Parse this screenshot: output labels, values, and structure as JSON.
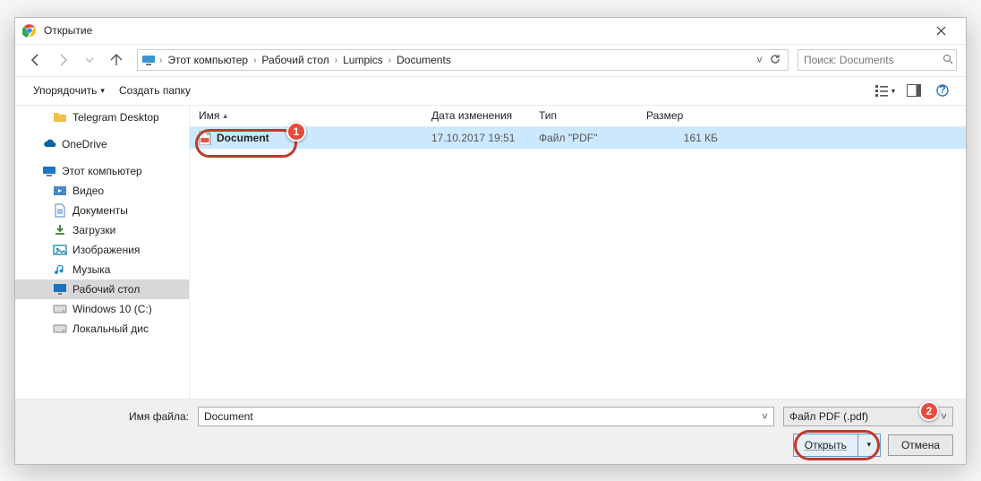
{
  "window": {
    "title": "Открытие"
  },
  "nav": {
    "breadcrumb": [
      "Этот компьютер",
      "Рабочий стол",
      "Lumpics",
      "Documents"
    ],
    "search_placeholder": "Поиск: Documents"
  },
  "toolbar": {
    "organize": "Упорядочить",
    "newfolder": "Создать папку"
  },
  "sidebar": [
    {
      "label": "Telegram Desktop",
      "icon": "folder-icon",
      "color": "#f3c14b",
      "indent": true
    },
    {
      "label": "OneDrive",
      "icon": "cloud-icon",
      "color": "#0a64a4",
      "sep": true
    },
    {
      "label": "Этот компьютер",
      "icon": "pc-icon",
      "color": "#1a74c3",
      "sep": true
    },
    {
      "label": "Видео",
      "icon": "video-icon",
      "color": "#4a86c5",
      "indent": true
    },
    {
      "label": "Документы",
      "icon": "doc-icon",
      "color": "#4a86c5",
      "indent": true
    },
    {
      "label": "Загрузки",
      "icon": "download-icon",
      "color": "#3b7a2e",
      "indent": true
    },
    {
      "label": "Изображения",
      "icon": "image-icon",
      "color": "#2b8fb3",
      "indent": true
    },
    {
      "label": "Музыка",
      "icon": "music-icon",
      "color": "#1a8fd2",
      "indent": true
    },
    {
      "label": "Рабочий стол",
      "icon": "desktop-icon",
      "color": "#1a74c3",
      "indent": true,
      "sel": true
    },
    {
      "label": "Windows 10 (C:)",
      "icon": "drive-icon",
      "color": "#888",
      "indent": true
    },
    {
      "label": "Локальный дис",
      "icon": "drive-icon",
      "color": "#888",
      "indent": true
    }
  ],
  "columns": {
    "name": "Имя",
    "date": "Дата изменения",
    "type": "Тип",
    "size": "Размер"
  },
  "files": [
    {
      "name": "Document",
      "date": "17.10.2017 19:51",
      "type": "Файл \"PDF\"",
      "size": "161 КБ"
    }
  ],
  "bottom": {
    "label": "Имя файла:",
    "value": "Document",
    "filetype": "Файл PDF (.pdf)",
    "open": "Открыть",
    "cancel": "Отмена"
  },
  "badges": {
    "one": "1",
    "two": "2"
  }
}
